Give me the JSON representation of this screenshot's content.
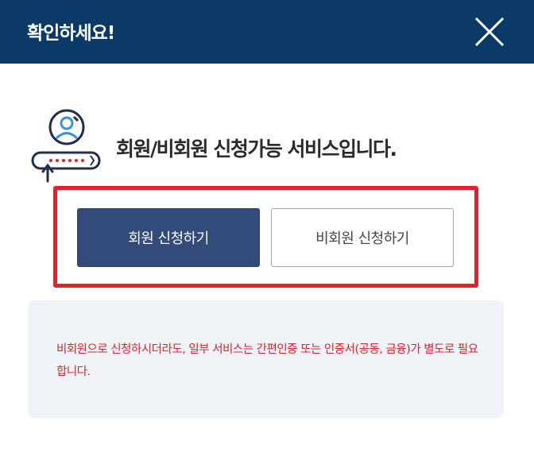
{
  "header": {
    "title": "확인하세요!",
    "close_icon": "close-icon",
    "background_color": "#0b3a68"
  },
  "main": {
    "icon": "user-login-icon",
    "heading": "회원/비회원 신청가능 서비스입니다.",
    "highlight_color": "#e4202a",
    "buttons": {
      "member_label": "회원 신청하기",
      "guest_label": "비회원 신청하기"
    }
  },
  "notice": {
    "text": "비회원으로 신청하시더라도, 일부 서비스는 간편인증 또는 인증서(공동, 금융)가 별도로 필요합니다.",
    "text_color": "#d9252f",
    "background_color": "#eff2f7"
  }
}
